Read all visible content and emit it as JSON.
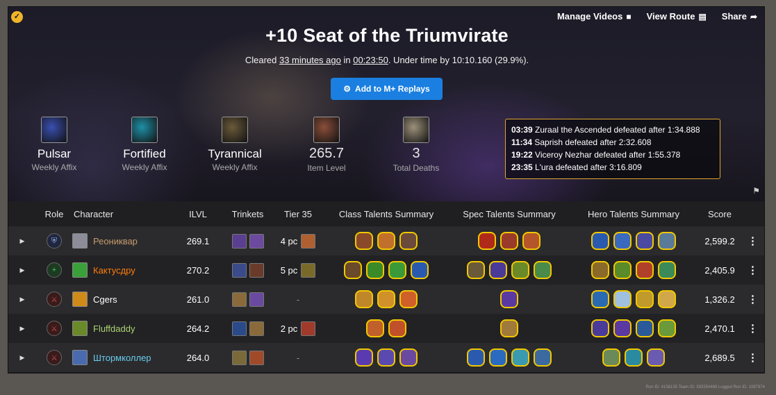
{
  "header": {
    "title": "+10 Seat of the Triumvirate",
    "cleared_prefix": "Cleared ",
    "cleared_ago": "33 minutes ago",
    "cleared_in": " in ",
    "cleared_time": "00:23:50",
    "cleared_suffix": ". Under time by 10:10.160 (29.9%).",
    "actions": {
      "manage_videos": "Manage Videos",
      "view_route": "View Route",
      "share": "Share"
    },
    "replay_button": "Add to M+ Replays"
  },
  "stats": [
    {
      "label": "Pulsar",
      "sub": "Weekly Affix",
      "icon": "pulsar-affix-icon",
      "color": "#3a4fb0"
    },
    {
      "label": "Fortified",
      "sub": "Weekly Affix",
      "icon": "fortified-affix-icon",
      "color": "#1f8fa6"
    },
    {
      "label": "Tyrannical",
      "sub": "Weekly Affix",
      "icon": "tyrannical-affix-icon",
      "color": "#6b5a3a"
    },
    {
      "label": "265.7",
      "sub": "Item Level",
      "icon": "arm-icon",
      "color": "#8a4e3a"
    },
    {
      "label": "3",
      "sub": "Total Deaths",
      "icon": "skull-icon",
      "color": "#9b9079"
    }
  ],
  "bosses": [
    {
      "time": "03:39",
      "text": "Zuraal the Ascended defeated after 1:34.888"
    },
    {
      "time": "11:34",
      "text": "Saprish defeated after 2:32.608"
    },
    {
      "time": "19:22",
      "text": "Viceroy Nezhar defeated after 1:55.378"
    },
    {
      "time": "23:35",
      "text": "L'ura defeated after 3:16.809"
    }
  ],
  "table": {
    "headers": {
      "role": "Role",
      "character": "Character",
      "ilvl": "ILVL",
      "trinkets": "Trinkets",
      "tier": "Tier 35",
      "class_talents": "Class Talents Summary",
      "spec_talents": "Spec Talents Summary",
      "hero_talents": "Hero Talents Summary",
      "score": "Score"
    },
    "rows": [
      {
        "name": "Реониквар",
        "name_color": "#c69b6d",
        "role": "tank",
        "role_symbol": "⛨",
        "ilvl": "269.1",
        "tier": "4 pc",
        "score": "2,599.2",
        "spec_color": "#8d8d9a",
        "trinkets": [
          "#5a3e8f",
          "#6b4aa0"
        ],
        "tier_color": "#b06030",
        "class_talents": [
          "#8a4a2a",
          "#c0702a",
          "#6a4a3a"
        ],
        "spec_talents": [
          "#b02a1a",
          "#9a3a2a",
          "#b5552a"
        ],
        "hero_talents": [
          "#2a5ab0",
          "#3a6ac0",
          "#4a4aa0",
          "#5a7a9a"
        ]
      },
      {
        "name": "Кактусдру",
        "name_color": "#ff7c0a",
        "role": "healer",
        "role_symbol": "+",
        "ilvl": "270.2",
        "tier": "5 pc",
        "score": "2,405.9",
        "spec_color": "#3aa03a",
        "trinkets": [
          "#3a4a8a",
          "#6a3a2a"
        ],
        "tier_color": "#7a6a2a",
        "class_talents": [
          "#6a4a2a",
          "#3a8a2a",
          "#3a9a3a",
          "#2a5ab0"
        ],
        "spec_talents": [
          "#6a5a3a",
          "#4a3a9a",
          "#6a8a2a",
          "#4a8a4a"
        ],
        "hero_talents": [
          "#8a6a2a",
          "#5a8a2a",
          "#b0402a",
          "#3a8a5a"
        ]
      },
      {
        "name": "Cgers",
        "name_color": "#ffffff",
        "role": "dps",
        "role_symbol": "⚔",
        "ilvl": "261.0",
        "tier": "-",
        "score": "1,326.2",
        "spec_color": "#d08a1a",
        "trinkets": [
          "#8a6a3a",
          "#6a4aa0"
        ],
        "tier_color": "",
        "class_talents": [
          "#c0862a",
          "#d0902a",
          "#d0602a"
        ],
        "spec_talents": [
          "#5a3aa0"
        ],
        "hero_talents": [
          "#2a6ab0",
          "#a0c0e0",
          "#c09a2a",
          "#d0a84a"
        ]
      },
      {
        "name": "Fluffdaddy",
        "name_color": "#aad372",
        "role": "dps",
        "role_symbol": "⚔",
        "ilvl": "264.2",
        "tier": "2 pc",
        "score": "2,470.1",
        "spec_color": "#6a8a2a",
        "trinkets": [
          "#2a4a8a",
          "#8a6a3a"
        ],
        "tier_color": "#a03a2a",
        "class_talents": [
          "#c0602a",
          "#c0502a"
        ],
        "spec_talents": [
          "#a07a3a"
        ],
        "hero_talents": [
          "#4a3a9a",
          "#5a3aa0",
          "#2a5a9a",
          "#6a9a3a"
        ]
      },
      {
        "name": "Штормколлер",
        "name_color": "#68ccef",
        "role": "dps",
        "role_symbol": "⚔",
        "ilvl": "264.0",
        "tier": "-",
        "score": "2,689.5",
        "spec_color": "#4a6ab0",
        "trinkets": [
          "#7a6a3a",
          "#a04a2a"
        ],
        "tier_color": "",
        "class_talents": [
          "#5a3ab0",
          "#5a4ab0",
          "#6a4aa0"
        ],
        "spec_talents": [
          "#2a5ab0",
          "#2a6ac0",
          "#3a9ab0",
          "#3a6aa0"
        ],
        "hero_talents": [
          "#6a8a5a",
          "#2a8aa0",
          "#6a5ab0"
        ]
      }
    ]
  },
  "footer_ids": "Run ID: 4158135   Team ID: 393354469   Logged Run ID: 1087974"
}
